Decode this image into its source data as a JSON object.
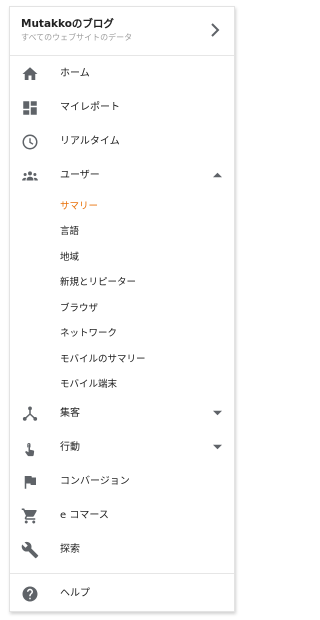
{
  "header": {
    "title": "Mutakkoのブログ",
    "subtitle": "すべてのウェブサイトのデータ",
    "chevron_icon": "chevron-right-icon"
  },
  "nav": {
    "home": {
      "label": "ホーム",
      "icon": "home-icon"
    },
    "my_report": {
      "label": "マイレポート",
      "icon": "dashboard-icon"
    },
    "realtime": {
      "label": "リアルタイム",
      "icon": "clock-icon"
    },
    "users": {
      "label": "ユーザー",
      "icon": "people-icon",
      "expanded": true,
      "children": [
        "サマリー",
        "言語",
        "地域",
        "新規とリピーター",
        "ブラウザ",
        "ネットワーク",
        "モバイルのサマリー",
        "モバイル端末"
      ],
      "active_child": "サマリー"
    },
    "acquisition": {
      "label": "集客",
      "icon": "acquisition-icon"
    },
    "behavior": {
      "label": "行動",
      "icon": "touch-icon"
    },
    "conversion": {
      "label": "コンバージョン",
      "icon": "flag-icon"
    },
    "ecommerce": {
      "label": "e コマース",
      "icon": "cart-icon"
    },
    "explore": {
      "label": "探索",
      "icon": "wrench-icon"
    }
  },
  "footer": {
    "help": {
      "label": "ヘルプ",
      "icon": "help-icon"
    }
  },
  "colors": {
    "accent": "#e8710a",
    "icon": "#5f6368",
    "text": "#212121"
  }
}
